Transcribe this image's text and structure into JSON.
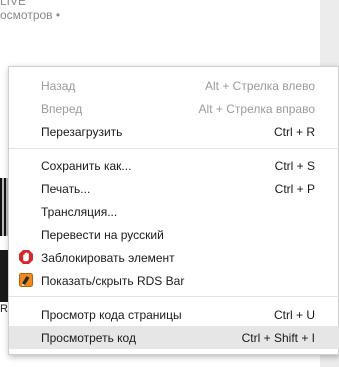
{
  "background": {
    "line1": "LIVE",
    "line2": "осмотров •",
    "edge_letter": "R"
  },
  "menu": {
    "items": [
      {
        "label": "Назад",
        "shortcut": "Alt + Стрелка влево"
      },
      {
        "label": "Вперед",
        "shortcut": "Alt + Стрелка вправо"
      },
      {
        "label": "Перезагрузить",
        "shortcut": "Ctrl + R"
      },
      {
        "label": "Сохранить как...",
        "shortcut": "Ctrl + S"
      },
      {
        "label": "Печать...",
        "shortcut": "Ctrl + P"
      },
      {
        "label": "Трансляция..."
      },
      {
        "label": "Перевести на русский"
      },
      {
        "label": "Заблокировать элемент",
        "icon": "adblock-stop-icon"
      },
      {
        "label": "Показать/скрыть RDS Bar",
        "icon": "rds-bar-icon"
      },
      {
        "label": "Просмотр кода страницы",
        "shortcut": "Ctrl + U"
      },
      {
        "label": "Просмотреть код",
        "shortcut": "Ctrl + Shift + I"
      }
    ]
  },
  "colors": {
    "menu_bg": "#ffffff",
    "hover_bg": "#e6e6e6",
    "disabled_text": "#9a9a9a",
    "adblock_red": "#d6272b",
    "rds_orange": "#f08a1c"
  }
}
